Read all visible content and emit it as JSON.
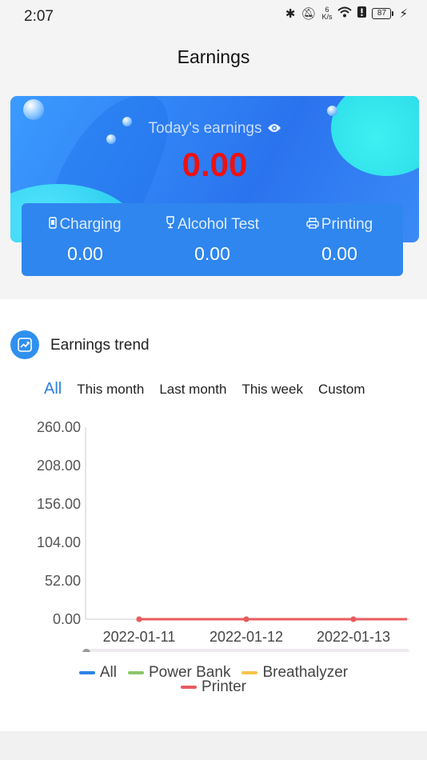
{
  "status": {
    "time": "2:07",
    "speed_value": "6",
    "speed_unit": "K/s",
    "battery": "87"
  },
  "header": {
    "title": "Earnings"
  },
  "summary": {
    "today_label": "Today's earnings",
    "today_amount": "0.00",
    "stats": [
      {
        "label": "Charging",
        "value": "0.00",
        "icon": "power-bank-icon"
      },
      {
        "label": "Alcohol Test",
        "value": "0.00",
        "icon": "wine-glass-icon"
      },
      {
        "label": "Printing",
        "value": "0.00",
        "icon": "printer-icon"
      }
    ]
  },
  "trend": {
    "title": "Earnings trend",
    "tabs": [
      "All",
      "This month",
      "Last month",
      "This week",
      "Custom"
    ],
    "active_tab": "All"
  },
  "chart_data": {
    "type": "line",
    "x": [
      "2022-01-11",
      "2022-01-12",
      "2022-01-13"
    ],
    "y_ticks": [
      "0.00",
      "52.00",
      "104.00",
      "156.00",
      "208.00",
      "260.00"
    ],
    "ylim": [
      0,
      260
    ],
    "series": [
      {
        "name": "All",
        "color": "#2b82e4",
        "values": [
          0,
          0,
          0
        ]
      },
      {
        "name": "Power Bank",
        "color": "#8cc56a",
        "values": [
          0,
          0,
          0
        ]
      },
      {
        "name": "Breathalyzer",
        "color": "#f7c44a",
        "values": [
          0,
          0,
          0
        ]
      },
      {
        "name": "Printer",
        "color": "#e85b5f",
        "values": [
          0,
          0,
          0
        ]
      }
    ],
    "legend_position": "bottom"
  }
}
